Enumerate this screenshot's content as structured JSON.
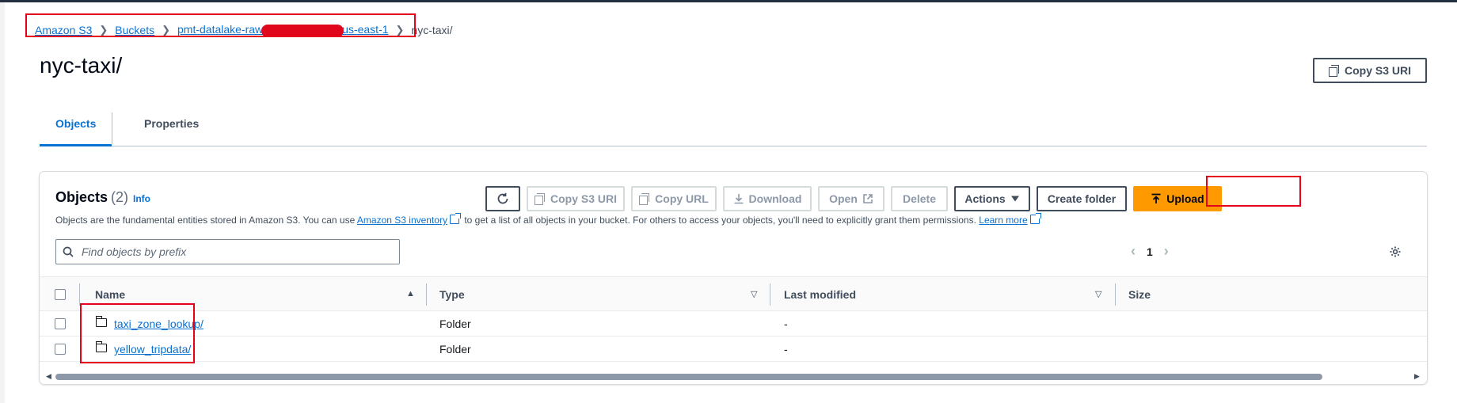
{
  "breadcrumb": {
    "items": [
      "Amazon S3",
      "Buckets",
      "pmt-datalake-raw",
      "us-east-1"
    ],
    "current": "nyc-taxi/"
  },
  "page": {
    "title": "nyc-taxi/",
    "copy_s3_uri": "Copy S3 URI"
  },
  "tabs": [
    {
      "label": "Objects",
      "active": true
    },
    {
      "label": "Properties",
      "active": false
    }
  ],
  "objects_panel": {
    "title": "Objects",
    "count": "(2)",
    "info": "Info",
    "desc_1": "Objects are the fundamental entities stored in Amazon S3. You can use",
    "desc_link_1": "Amazon S3 inventory",
    "desc_2": "to get a list of all objects in your bucket. For others to access your objects, you'll need to explicitly grant them permissions.",
    "desc_link_2": "Learn more",
    "toolbar": {
      "refresh": "refresh-icon",
      "copy_s3_uri": "Copy S3 URI",
      "copy_url": "Copy URL",
      "download": "Download",
      "open": "Open",
      "delete": "Delete",
      "actions": "Actions",
      "create_folder": "Create folder",
      "upload": "Upload"
    },
    "search_placeholder": "Find objects by prefix",
    "page_number": "1",
    "columns": [
      "Name",
      "Type",
      "Last modified",
      "Size"
    ],
    "rows": [
      {
        "name": "taxi_zone_lookup/",
        "type": "Folder",
        "last_modified": "-",
        "size": ""
      },
      {
        "name": "yellow_tripdata/",
        "type": "Folder",
        "last_modified": "-",
        "size": ""
      }
    ]
  },
  "colors": {
    "link": "#0972d3",
    "primary": "#ff9900",
    "highlight": "#e5001b"
  }
}
